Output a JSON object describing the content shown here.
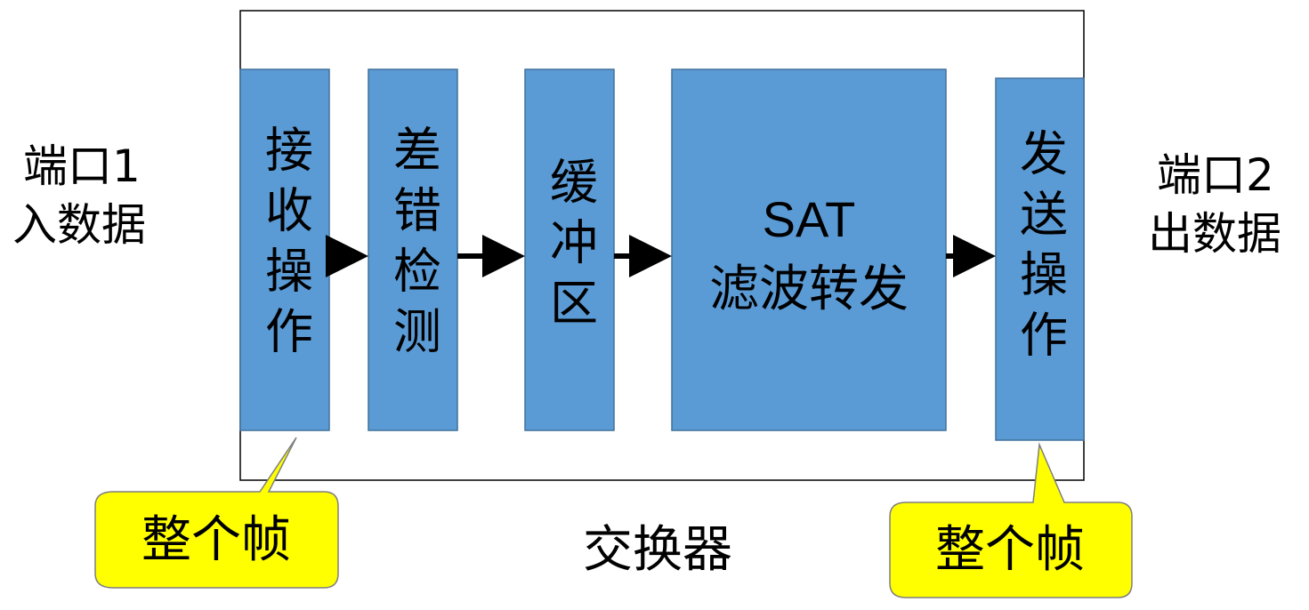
{
  "labels": {
    "port1_line1": "端口1",
    "port1_line2": "入数据",
    "port2_line1": "端口2",
    "port2_line2": "出数据",
    "switch": "交换器"
  },
  "blocks": [
    {
      "id": "receive",
      "label": "接收操作"
    },
    {
      "id": "error-check",
      "label": "差错检测"
    },
    {
      "id": "buffer",
      "label": "缓冲区"
    },
    {
      "id": "sat",
      "label_line1": "SAT",
      "label_line2": "滤波转发"
    },
    {
      "id": "send",
      "label": "发送操作"
    }
  ],
  "callouts": {
    "left": "整个帧",
    "right": "整个帧"
  },
  "colors": {
    "block_fill": "#5B9BD5",
    "block_stroke": "#41719C",
    "callout_fill": "#FFFF00",
    "callout_stroke": "#7F7F7F",
    "arrow": "#000000",
    "frame": "#000000"
  }
}
